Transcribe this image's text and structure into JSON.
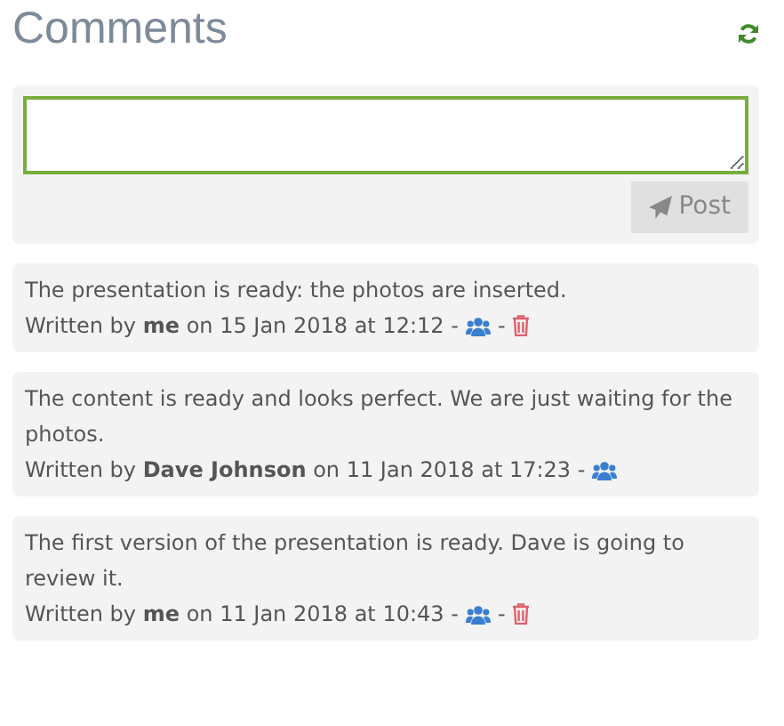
{
  "title": "Comments",
  "composer": {
    "button": "Post"
  },
  "comments": [
    {
      "text": "The presentation is ready: the photos are inserted.",
      "meta": "Written by **me** on 15 Jan 2018 at 12:12 -",
      "deletable": true,
      "separator": "-"
    },
    {
      "text": "The content is ready and looks perfect. We are just waiting for the photos.",
      "meta": "Written by **Dave Johnson** on 11 Jan 2018 at 17:23 -",
      "deletable": false
    },
    {
      "text": "The first version of the presentation is ready. Dave is going to review it.",
      "meta": "Written by **me** on 11 Jan 2018 at 10:43 -",
      "deletable": true,
      "separator": "-"
    }
  ]
}
